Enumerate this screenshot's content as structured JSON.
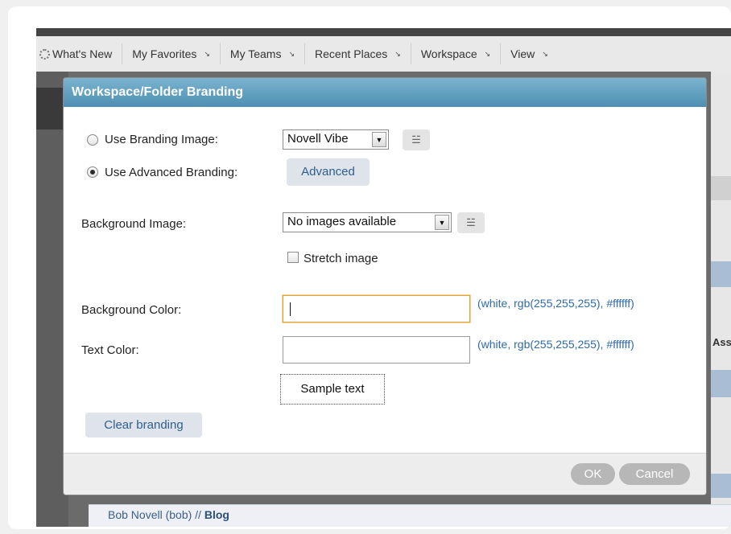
{
  "menubar": {
    "items": [
      {
        "label": "What's New",
        "icon": "spinner-icon",
        "has_arrow": false
      },
      {
        "label": "My Favorites",
        "has_arrow": true
      },
      {
        "label": "My Teams",
        "has_arrow": true
      },
      {
        "label": "Recent Places",
        "has_arrow": true
      },
      {
        "label": "Workspace",
        "has_arrow": true
      },
      {
        "label": "View",
        "has_arrow": true
      }
    ],
    "arrow_glyph": "↘"
  },
  "background": {
    "right_column_text": "Assi",
    "breadcrumb_user": "Bob Novell (bob) // ",
    "breadcrumb_page": "Blog"
  },
  "dialog": {
    "title": "Workspace/Folder Branding",
    "branding_image_label": "Use Branding Image:",
    "branding_image_selected": "Novell Vibe",
    "advanced_branding_label": "Use Advanced Branding:",
    "advanced_button": "Advanced",
    "selected_mode": "advanced",
    "background_image_label": "Background Image:",
    "background_image_selected": "No images available",
    "stretch_image_label": "Stretch image",
    "stretch_image_checked": false,
    "background_color_label": "Background Color:",
    "background_color_value": "",
    "background_color_hint": "(white, rgb(255,255,255), #ffffff)",
    "text_color_label": "Text Color:",
    "text_color_value": "",
    "text_color_hint": "(white, rgb(255,255,255), #ffffff)",
    "sample_text": "Sample text",
    "clear_branding_button": "Clear branding",
    "ok_button": "OK",
    "cancel_button": "Cancel"
  },
  "colors": {
    "title_bar": "#5c9ec0",
    "link": "#2f6aa8",
    "focus_border": "#e0a23a",
    "footer_button": "#b7b7b7"
  }
}
